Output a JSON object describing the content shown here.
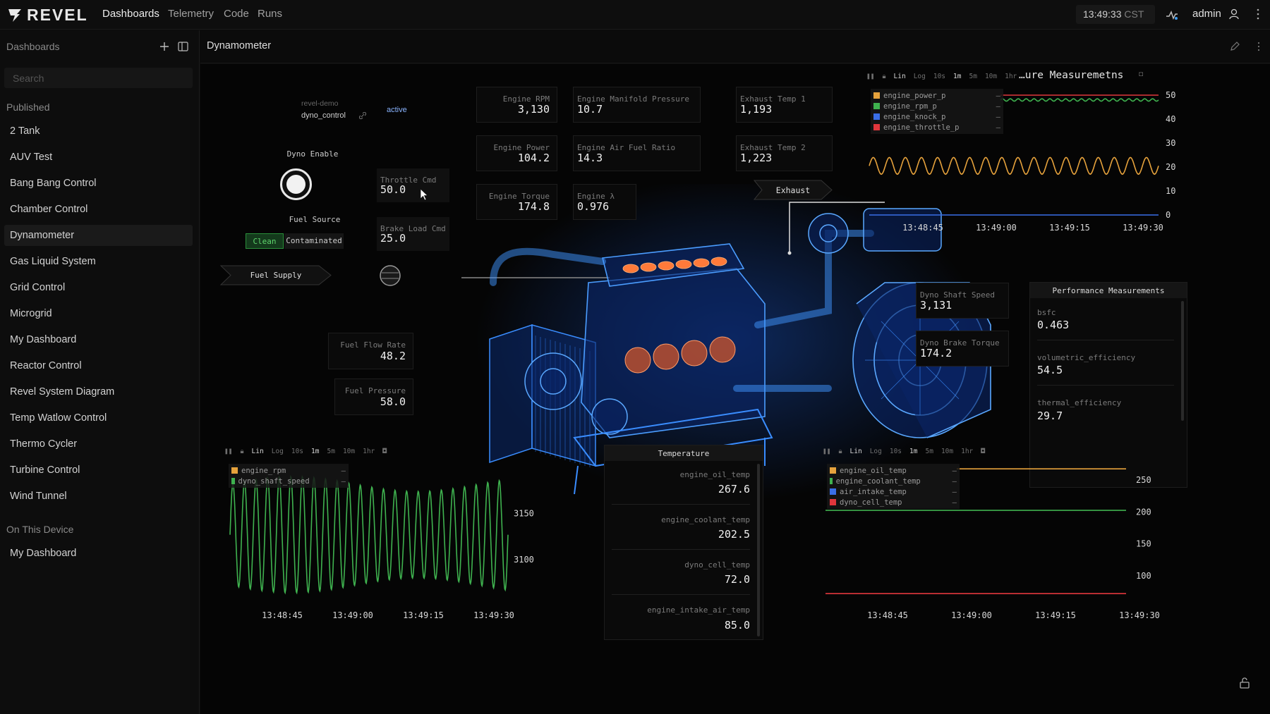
{
  "topbar": {
    "logo": "REVEL",
    "nav": [
      "Dashboards",
      "Telemetry",
      "Code",
      "Runs"
    ],
    "time": "13:49:33",
    "tz": "CST",
    "user": "admin"
  },
  "sidebar": {
    "title": "Dashboards",
    "search_placeholder": "Search",
    "published_label": "Published",
    "published": [
      "2 Tank",
      "AUV Test",
      "Bang Bang Control",
      "Chamber Control",
      "Dynamometer",
      "Gas Liquid System",
      "Grid Control",
      "Microgrid",
      "My Dashboard",
      "Reactor Control",
      "Revel System Diagram",
      "Temp Watlow Control",
      "Thermo Cycler",
      "Turbine Control",
      "Wind Tunnel"
    ],
    "device_label": "On This Device",
    "device": [
      "My Dashboard"
    ],
    "active_item": "Dynamometer"
  },
  "main": {
    "title": "Dynamometer"
  },
  "control": {
    "system": "revel-demo",
    "sequence": "dyno_control",
    "status": "active",
    "dyno_enable_label": "Dyno Enable",
    "fuel_source_label": "Fuel Source",
    "fuel_options": [
      "Clean",
      "Contaminated"
    ],
    "fuel_selected": "Clean",
    "fuel_supply_label": "Fuel Supply",
    "exhaust_label": "Exhaust"
  },
  "metrics": {
    "throttle_cmd": {
      "label": "Throttle Cmd",
      "value": "50.0"
    },
    "brake_load_cmd": {
      "label": "Brake Load Cmd",
      "value": "25.0"
    },
    "engine_rpm": {
      "label": "Engine RPM",
      "value": "3,130"
    },
    "engine_power": {
      "label": "Engine Power",
      "value": "104.2"
    },
    "engine_torque": {
      "label": "Engine Torque",
      "value": "174.8"
    },
    "manifold_pressure": {
      "label": "Engine Manifold Pressure",
      "value": "10.7"
    },
    "air_fuel_ratio": {
      "label": "Engine Air Fuel Ratio",
      "value": "14.3"
    },
    "engine_lambda": {
      "label": "Engine λ",
      "value": "0.976"
    },
    "exhaust_temp_1": {
      "label": "Exhaust Temp 1",
      "value": "1,193"
    },
    "exhaust_temp_2": {
      "label": "Exhaust Temp 2",
      "value": "1,223"
    },
    "fuel_flow_rate": {
      "label": "Fuel Flow Rate",
      "value": "48.2"
    },
    "fuel_pressure": {
      "label": "Fuel Pressure",
      "value": "58.0"
    },
    "dyno_shaft_speed": {
      "label": "Dyno Shaft Speed",
      "value": "3,131"
    },
    "dyno_brake_torque": {
      "label": "Dyno Brake Torque",
      "value": "174.2"
    }
  },
  "performance": {
    "title": "Performance Measurements",
    "items": [
      {
        "label": "bsfc",
        "value": "0.463"
      },
      {
        "label": "volumetric_efficiency",
        "value": "54.5"
      },
      {
        "label": "thermal_efficiency",
        "value": "29.7"
      }
    ]
  },
  "temperature": {
    "title": "Temperature",
    "items": [
      {
        "label": "engine_oil_temp",
        "value": "267.6"
      },
      {
        "label": "engine_coolant_temp",
        "value": "202.5"
      },
      {
        "label": "dyno_cell_temp",
        "value": "72.0"
      },
      {
        "label": "engine_intake_air_temp",
        "value": "85.0"
      }
    ]
  },
  "plot_controls": [
    "Lin",
    "Log",
    "10s",
    "1m",
    "5m",
    "10m",
    "1hr"
  ],
  "chart_data": [
    {
      "type": "line",
      "title": "…ure Measuremetns",
      "x": [
        "13:48:45",
        "13:49:00",
        "13:49:15",
        "13:49:30"
      ],
      "ylim": [
        0,
        50
      ],
      "yticks": [
        0,
        10,
        20,
        30,
        40,
        50
      ],
      "series": [
        {
          "name": "engine_power_p",
          "color": "#e6a23c",
          "values": [
            24,
            17,
            24,
            17,
            24,
            17,
            24,
            17
          ]
        },
        {
          "name": "engine_rpm_p",
          "color": "#3fb24f",
          "values": [
            47.5,
            48.5,
            47.5,
            48.5,
            47.5,
            48.5,
            47.5,
            48.5
          ]
        },
        {
          "name": "engine_knock_p",
          "color": "#3a6ee8",
          "values": [
            0,
            0,
            0,
            0,
            0,
            0,
            0,
            0
          ]
        },
        {
          "name": "engine_throttle_p",
          "color": "#e0363c",
          "values": [
            50,
            50,
            50,
            50,
            50,
            50,
            50,
            50
          ]
        }
      ]
    },
    {
      "type": "line",
      "x": [
        "13:48:45",
        "13:49:00",
        "13:49:15",
        "13:49:30"
      ],
      "yticks": [
        3100,
        3150
      ],
      "series": [
        {
          "name": "engine_rpm",
          "color": "#e6a23c",
          "values": []
        },
        {
          "name": "dyno_shaft_speed",
          "color": "#3fb24f",
          "values": [
            3130,
            3188,
            3068,
            3186,
            3075,
            3180,
            3070,
            3190,
            3066,
            3176,
            3078,
            3184,
            3070,
            3180
          ]
        }
      ]
    },
    {
      "type": "line",
      "x": [
        "13:48:45",
        "13:49:00",
        "13:49:15",
        "13:49:30"
      ],
      "yticks": [
        100,
        150,
        200,
        250
      ],
      "series": [
        {
          "name": "engine_oil_temp",
          "color": "#e6a23c",
          "values": [
            267.6,
            267.6,
            267.6,
            267.6
          ]
        },
        {
          "name": "engine_coolant_temp",
          "color": "#3fb24f",
          "values": [
            202.5,
            202.5,
            202.5,
            202.5
          ]
        },
        {
          "name": "air_intake_temp",
          "color": "#3a6ee8",
          "values": []
        },
        {
          "name": "dyno_cell_temp",
          "color": "#e0363c",
          "values": [
            72,
            72,
            72,
            72
          ]
        }
      ]
    }
  ]
}
